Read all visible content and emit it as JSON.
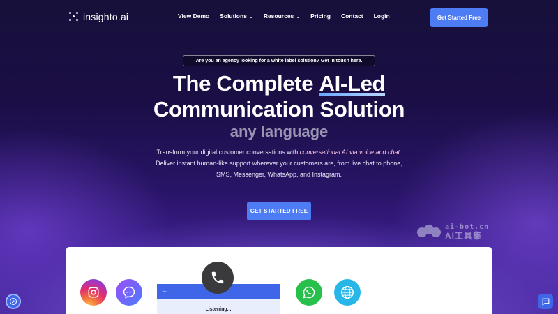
{
  "brand": {
    "name": "insighto.ai"
  },
  "nav": {
    "items": [
      {
        "label": "View Demo",
        "has_dropdown": false
      },
      {
        "label": "Solutions",
        "has_dropdown": true
      },
      {
        "label": "Resources",
        "has_dropdown": true
      },
      {
        "label": "Pricing",
        "has_dropdown": false
      },
      {
        "label": "Contact",
        "has_dropdown": false
      },
      {
        "label": "Login",
        "has_dropdown": false
      }
    ],
    "cta": "Get Started Free"
  },
  "hero": {
    "agency_banner": "Are you an agency looking for a white label solution? Get in touch here.",
    "title_prefix": "The Complete ",
    "title_highlight": "AI-Led",
    "title_line2": "Communication Solution",
    "rotating_text": "any language",
    "desc_line1_prefix": "Transform your digital customer conversations with ",
    "desc_line1_highlight": "conversational AI via voice and chat",
    "desc_line1_suffix": ".",
    "desc_line2": "Deliver instant human-like support wherever your customers are, from live chat to phone,",
    "desc_line3": "SMS, Messenger, WhatsApp, and Instagram.",
    "cta": "GET STARTED FREE"
  },
  "demo": {
    "status": "Listening...",
    "channels": [
      "instagram-icon",
      "messenger-icon",
      "phone-icon",
      "whatsapp-icon",
      "globe-icon"
    ]
  },
  "watermark": {
    "line1": "ai-bot.cn",
    "line2": "AI工具集"
  },
  "colors": {
    "accent": "#4d7cf5",
    "bg_top": "#17103a",
    "bg_bottom": "#4a2ca3",
    "highlight_underline": "#8ab8ff",
    "emphasis_text": "#ffc8e6"
  }
}
